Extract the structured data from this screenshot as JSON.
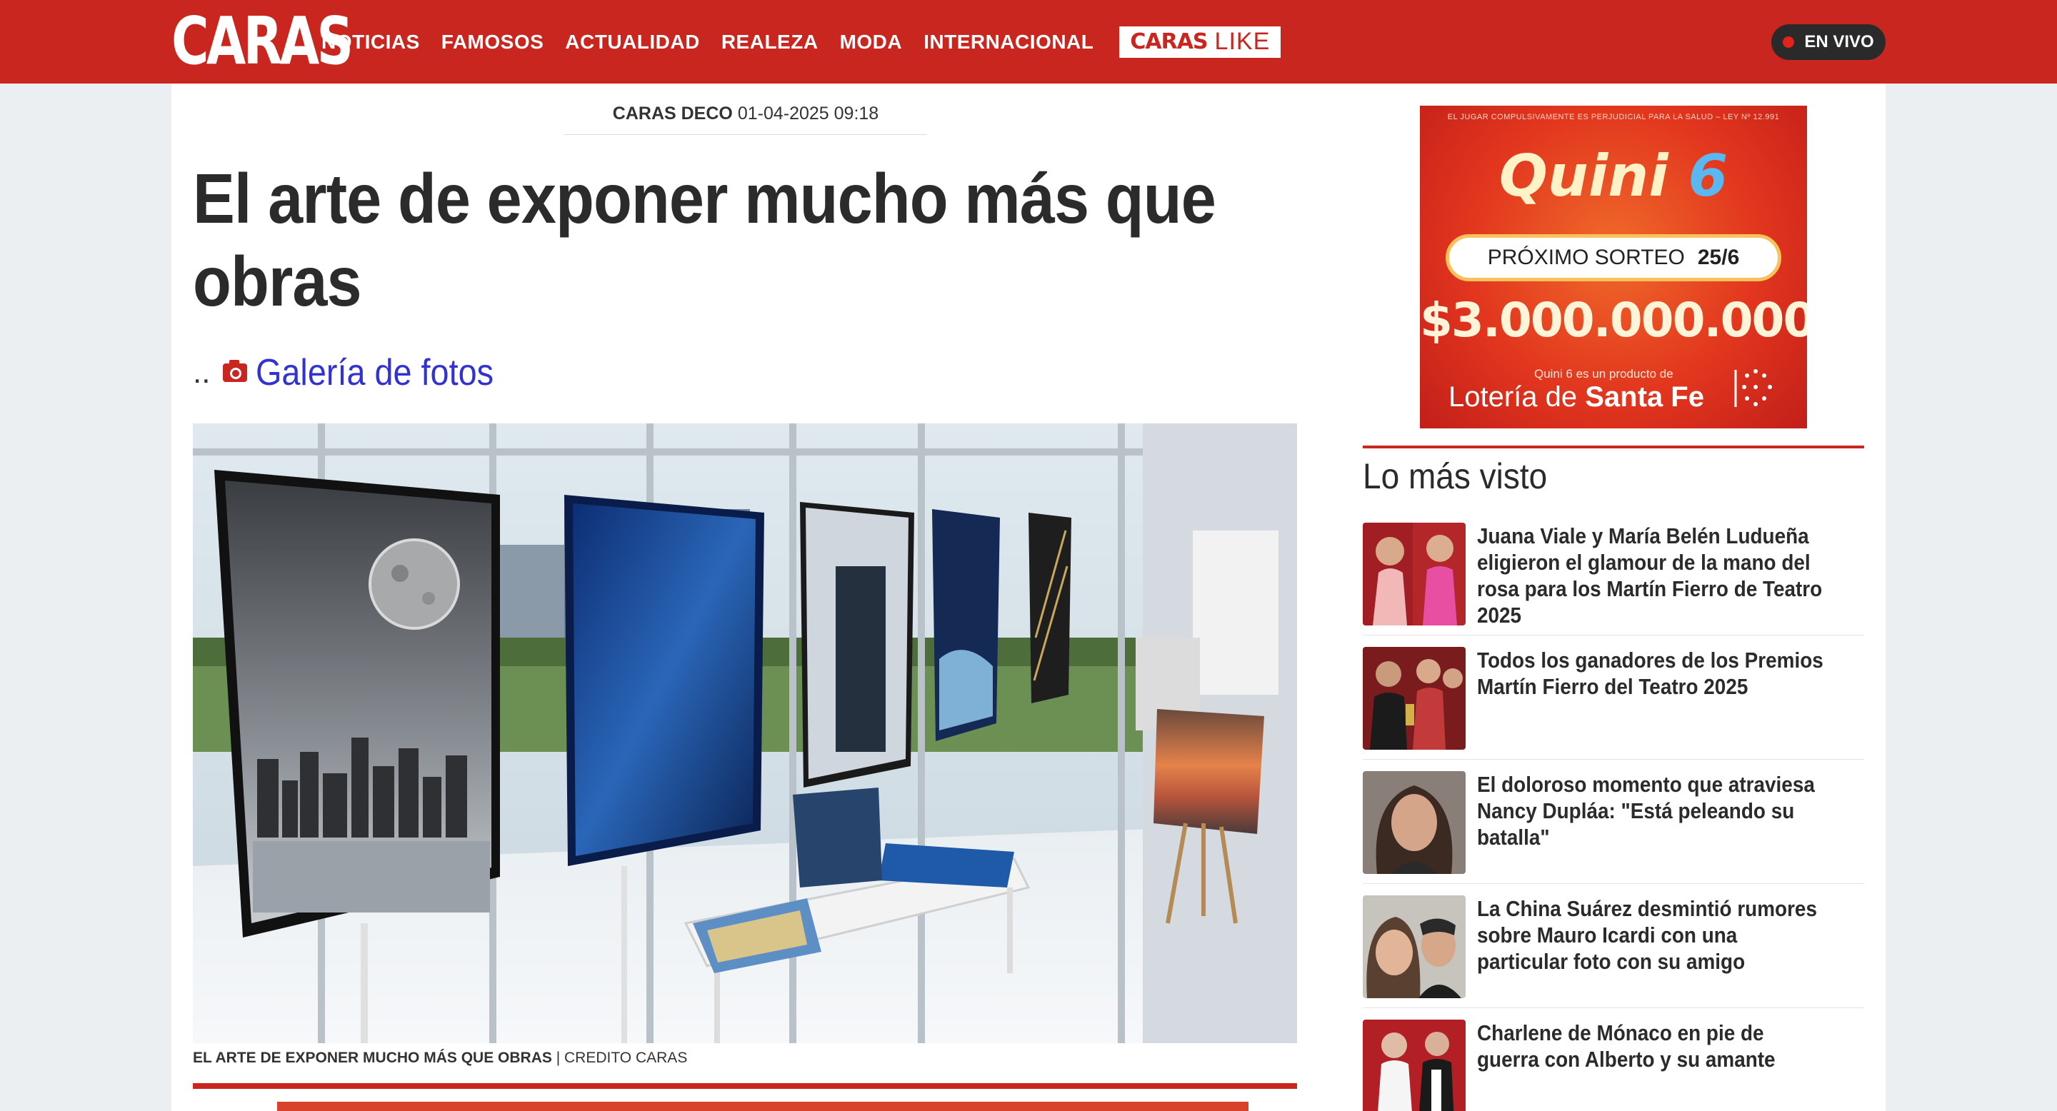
{
  "header": {
    "logo": "CARAS",
    "nav": [
      "NOTICIAS",
      "FAMOSOS",
      "ACTUALIDAD",
      "REALEZA",
      "MODA",
      "INTERNACIONAL"
    ],
    "caras_like": {
      "part_a": "CARAS",
      "part_b": "LIKE"
    },
    "live_label": "EN VIVO",
    "brand_color": "#c8261e"
  },
  "article": {
    "section": "CARAS DECO",
    "date": "01-04-2025 09:18",
    "title": "El arte de exponer mucho más que obras",
    "sub_dots": "..",
    "gallery_label": "Galería de fotos",
    "caption_bold": "EL ARTE DE EXPONER MUCHO MÁS QUE OBRAS",
    "caption_sep": " | ",
    "caption_credit": "CREDITO CARAS"
  },
  "ad": {
    "legal": "EL JUGAR COMPULSIVAMENTE ES PERJUDICIAL PARA LA SALUD – LEY Nº 12.991",
    "brand_a": "Quini ",
    "brand_b": "6",
    "next_draw_label": "PRÓXIMO SORTEO",
    "next_draw_date": "25/6",
    "prize": "$3.000.000.000",
    "product_note": "Quini 6 es un producto de",
    "lottery_a": "Lotería de ",
    "lottery_b": "Santa Fe"
  },
  "sidebar": {
    "title": "Lo más visto",
    "items": [
      {
        "title": "Juana Viale y María Belén Ludueña eligieron el glamour de la mano del rosa para los Martín Fierro de Teatro 2025"
      },
      {
        "title": "Todos los ganadores de los Premios Martín Fierro del Teatro 2025"
      },
      {
        "title": "El doloroso momento que atraviesa Nancy Dupláa: \"Está peleando su batalla\""
      },
      {
        "title": "La China Suárez desmintió rumores sobre Mauro Icardi con una particular foto con su amigo"
      },
      {
        "title": "Charlene de Mónaco en pie de guerra con Alberto y su amante"
      }
    ]
  }
}
